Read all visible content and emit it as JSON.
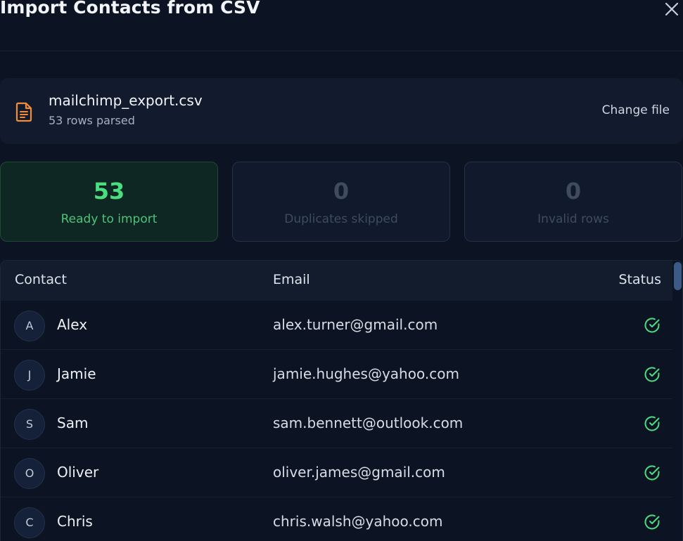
{
  "modal": {
    "title": "Import Contacts from CSV",
    "close_icon": "close-icon"
  },
  "file": {
    "icon": "file-text-icon",
    "name": "mailchimp_export.csv",
    "rows": "53 rows parsed",
    "change_label": "Change file"
  },
  "stats": {
    "ready": {
      "count": "53",
      "label": "Ready to import"
    },
    "duplicates": {
      "count": "0",
      "label": "Duplicates skipped"
    },
    "invalid": {
      "count": "0",
      "label": "Invalid rows"
    }
  },
  "table": {
    "headers": {
      "contact": "Contact",
      "email": "Email",
      "status": "Status"
    },
    "rows": [
      {
        "initial": "A",
        "name": "Alex",
        "email": "alex.turner@gmail.com",
        "status_icon": "check-circle-icon"
      },
      {
        "initial": "J",
        "name": "Jamie",
        "email": "jamie.hughes@yahoo.com",
        "status_icon": "check-circle-icon"
      },
      {
        "initial": "S",
        "name": "Sam",
        "email": "sam.bennett@outlook.com",
        "status_icon": "check-circle-icon"
      },
      {
        "initial": "O",
        "name": "Oliver",
        "email": "oliver.james@gmail.com",
        "status_icon": "check-circle-icon"
      },
      {
        "initial": "C",
        "name": "Chris",
        "email": "chris.walsh@yahoo.com",
        "status_icon": "check-circle-icon"
      }
    ]
  },
  "colors": {
    "background": "#0c1322",
    "card": "#121b2e",
    "success": "#4ade80",
    "file_icon": "#f28c38"
  }
}
